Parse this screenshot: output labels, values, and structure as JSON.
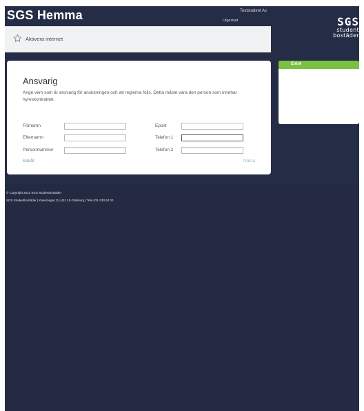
{
  "header": {
    "site_title": "SGS Hemma",
    "user_name": "Teststudent As",
    "logout_label": "Utgertset",
    "logo": {
      "main": "SGS",
      "line1": "student",
      "line2": "bostäder"
    }
  },
  "breadcrumb": {
    "label": "Aktivera internet",
    "icon": "star-icon"
  },
  "form": {
    "title": "Ansvarig",
    "description": "Ange vem som är ansvarig för anslutningen och att reglerna följs. Detta måste vara den person som innehar hyreskontraktet.",
    "fields": {
      "firstname": {
        "label": "Förnamn",
        "value": ""
      },
      "lastname": {
        "label": "Efternamn",
        "value": ""
      },
      "personnummer": {
        "label": "Personnummer",
        "value": ""
      },
      "email": {
        "label": "Epost",
        "value": ""
      },
      "phone1": {
        "label": "Telefon 1",
        "value": ""
      },
      "phone2": {
        "label": "Telefon 2",
        "value": ""
      }
    },
    "back_label": "Bakåt",
    "next_label": "Nästa"
  },
  "sidebar": {
    "heading": "Entré"
  },
  "footer": {
    "copyright": "© Copyright 2022 SGS Studentbostäder",
    "address": "SGS Studentbostäder  |  Kasernsgat 11  |  411 18 Göteborg  |  Tele 031-333 63 00"
  },
  "colors": {
    "page_bg": "#252d46",
    "sidebar_accent": "#7ac143",
    "link": "#8a96b8"
  }
}
